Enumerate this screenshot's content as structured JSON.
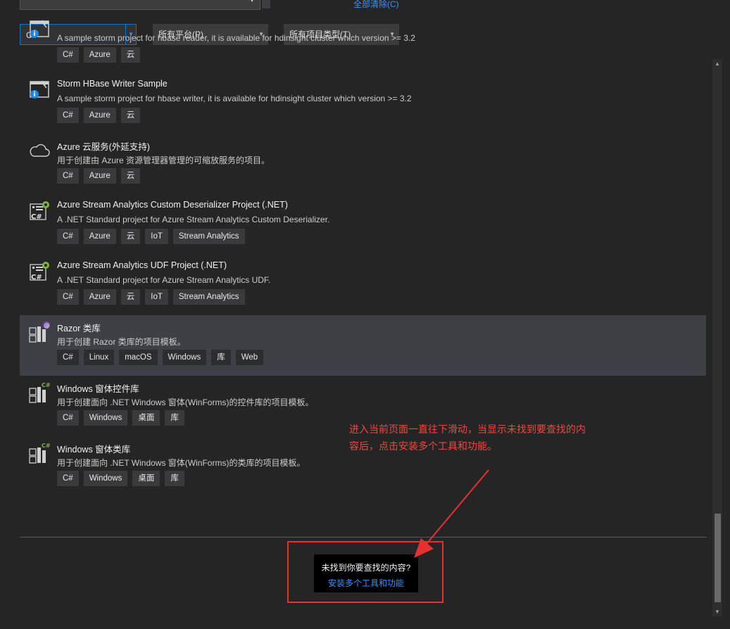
{
  "header": {
    "clear_all": "全部清除(C)",
    "language_filter": "C#",
    "platform_filter": "所有平台(P)",
    "project_type_filter": "所有项目类型(T)"
  },
  "templates": [
    {
      "title": "",
      "description": "A sample storm project for hbase reader, it is available for hdinsight cluster which version >= 3.2",
      "tags": [
        "C#",
        "Azure",
        "云"
      ],
      "icon": "storm-project-icon"
    },
    {
      "title": "Storm HBase Writer Sample",
      "description": "A sample storm project for hbase writer, it is available for hdinsight cluster which version >= 3.2",
      "tags": [
        "C#",
        "Azure",
        "云"
      ],
      "icon": "storm-project-icon"
    },
    {
      "title": "Azure 云服务(外延支持)",
      "description": "用于创建由 Azure 资源管理器管理的可缩放服务的项目。",
      "tags": [
        "C#",
        "Azure",
        "云"
      ],
      "icon": "cloud-icon"
    },
    {
      "title": "Azure Stream Analytics Custom Deserializer Project (.NET)",
      "description": "A .NET Standard project for Azure Stream Analytics Custom Deserializer.",
      "tags": [
        "C#",
        "Azure",
        "云",
        "IoT",
        "Stream Analytics"
      ],
      "icon": "csharp-gear-icon"
    },
    {
      "title": "Azure Stream Analytics UDF Project (.NET)",
      "description": "A .NET Standard project for Azure Stream Analytics UDF.",
      "tags": [
        "C#",
        "Azure",
        "云",
        "IoT",
        "Stream Analytics"
      ],
      "icon": "csharp-gear-icon"
    },
    {
      "title": "Razor 类库",
      "description": "用于创建 Razor 类库的项目模板。",
      "tags": [
        "C#",
        "Linux",
        "macOS",
        "Windows",
        "库",
        "Web"
      ],
      "icon": "razor-library-icon",
      "selected": true
    },
    {
      "title": "Windows 窗体控件库",
      "description": "用于创建面向 .NET Windows 窗体(WinForms)的控件库的项目模板。",
      "tags": [
        "C#",
        "Windows",
        "桌面",
        "库"
      ],
      "icon": "winforms-library-icon"
    },
    {
      "title": "Windows 窗体类库",
      "description": "用于创建面向 .NET Windows 窗体(WinForms)的类库的项目模板。",
      "tags": [
        "C#",
        "Windows",
        "桌面",
        "库"
      ],
      "icon": "winforms-library-icon"
    }
  ],
  "not_found": {
    "question": "未找到你要查找的内容?",
    "link": "安装多个工具和功能"
  },
  "annotation": {
    "text": "进入当前页面一直往下滑动，当显示未找到要查找的内容后，点击安装多个工具和功能。",
    "color": "#f0473c"
  }
}
